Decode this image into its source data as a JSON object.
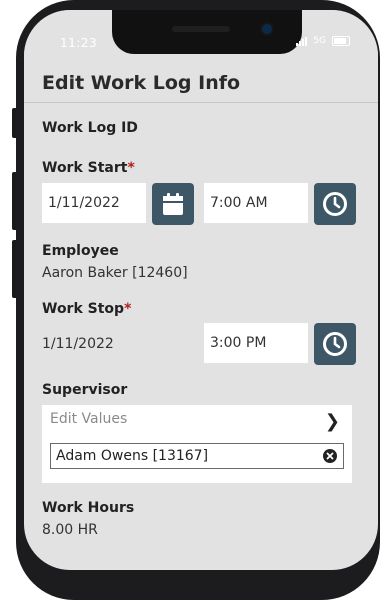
{
  "status_bar": {
    "time": "11:23",
    "network": "5G"
  },
  "header": {
    "title": "Edit Work Log Info"
  },
  "form": {
    "work_log_id": {
      "label": "Work Log ID"
    },
    "work_start": {
      "label": "Work Start",
      "required_mark": "*",
      "date": "1/11/2022",
      "time": "7:00 AM"
    },
    "employee": {
      "label": "Employee",
      "value": "Aaron Baker [12460]"
    },
    "work_stop": {
      "label": "Work Stop",
      "required_mark": "*",
      "date": "1/11/2022",
      "time": "3:00 PM"
    },
    "supervisor": {
      "label": "Supervisor",
      "edit_values": "Edit Values",
      "selected": "Adam Owens [13167]"
    },
    "work_hours": {
      "label": "Work Hours",
      "value": "8.00 HR"
    }
  },
  "icons": {
    "calendar": "calendar-icon",
    "clock": "clock-icon",
    "chevron": "chevron-right-icon",
    "clear": "clear-icon"
  },
  "colors": {
    "accent": "#3d5766",
    "required": "#b02020",
    "screen_bg": "#e2e2e2"
  }
}
